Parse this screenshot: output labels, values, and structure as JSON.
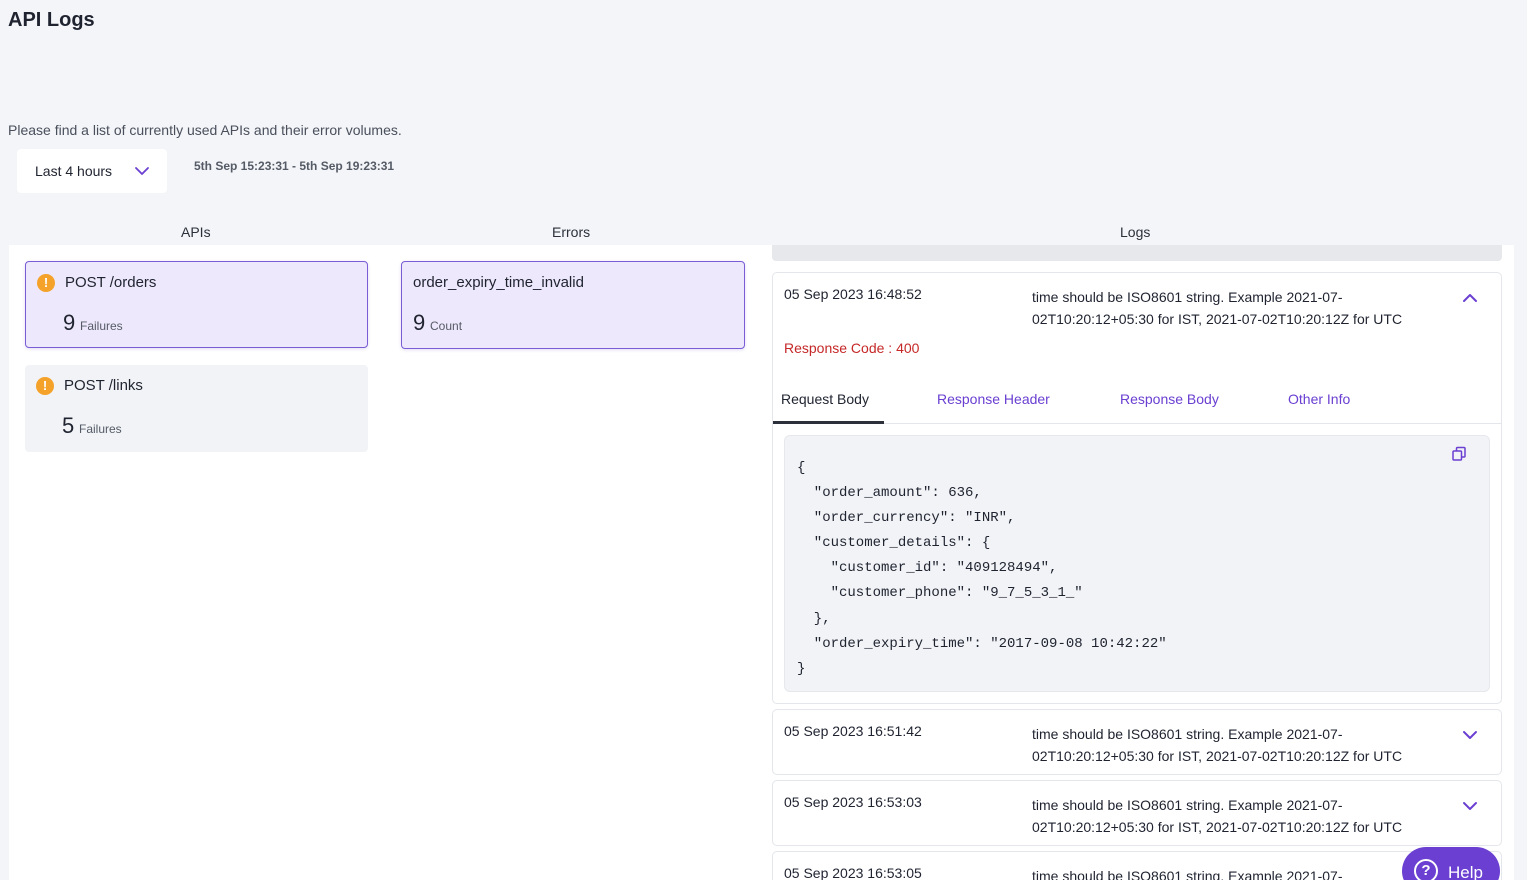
{
  "page": {
    "title": "API Logs",
    "subtitle": "Please find a list of currently used APIs and their error volumes."
  },
  "filter": {
    "range_label": "Last 4 hours",
    "range_text": "5th Sep 15:23:31 - 5th Sep 19:23:31"
  },
  "columns": {
    "apis": "APIs",
    "errors": "Errors",
    "logs": "Logs"
  },
  "apis": [
    {
      "name": "POST /orders",
      "count": "9",
      "count_label": "Failures",
      "selected": true
    },
    {
      "name": "POST /links",
      "count": "5",
      "count_label": "Failures",
      "selected": false
    }
  ],
  "errors": [
    {
      "name": "order_expiry_time_invalid",
      "count": "9",
      "count_label": "Count",
      "selected": true
    }
  ],
  "logs": [
    {
      "time": "05 Sep 2023 16:48:52",
      "message": "time should be ISO8601 string. Example 2021-07-02T10:20:12+05:30 for IST, 2021-07-02T10:20:12Z for UTC",
      "expanded": true,
      "response_code": "Response Code : 400",
      "tabs": [
        "Request Body",
        "Response Header",
        "Response Body",
        "Other Info"
      ],
      "active_tab": "Request Body",
      "request_body": "{\n  \"order_amount\": 636,\n  \"order_currency\": \"INR\",\n  \"customer_details\": {\n    \"customer_id\": \"409128494\",\n    \"customer_phone\": \"9_7_5_3_1_\"\n  },\n  \"order_expiry_time\": \"2017-09-08 10:42:22\"\n}"
    },
    {
      "time": "05 Sep 2023 16:51:42",
      "message": "time should be ISO8601 string. Example 2021-07-02T10:20:12+05:30 for IST, 2021-07-02T10:20:12Z for UTC",
      "expanded": false
    },
    {
      "time": "05 Sep 2023 16:53:03",
      "message": "time should be ISO8601 string. Example 2021-07-02T10:20:12+05:30 for IST, 2021-07-02T10:20:12Z for UTC",
      "expanded": false
    },
    {
      "time": "05 Sep 2023 16:53:05",
      "message": "time should be ISO8601 string. Example 2021-07-",
      "expanded": false
    }
  ],
  "help": {
    "label": "Help"
  },
  "colors": {
    "accent": "#6a3fd1",
    "selected_bg": "#ede8fb",
    "warning": "#f5a22a",
    "error_text": "#c62828"
  },
  "icons": {
    "range_chevron": "chevron-down-icon",
    "api_status": "warning-icon",
    "collapse": "chevron-up-icon",
    "expand": "chevron-down-icon",
    "copy": "copy-icon",
    "help": "question-circle-icon"
  }
}
